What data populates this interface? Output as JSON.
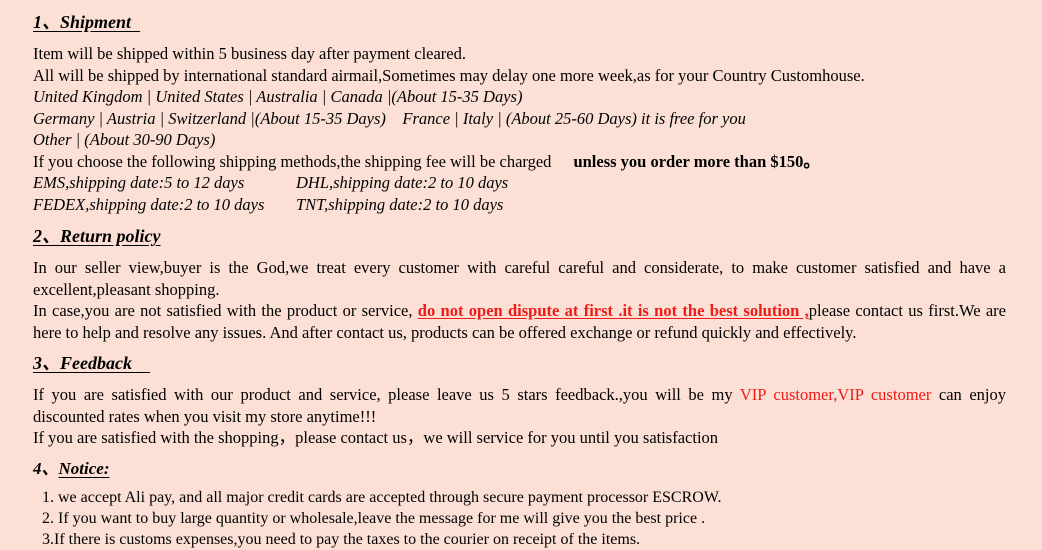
{
  "document": {
    "background_color": "#fce0d6",
    "accent_red": "#ee1b16",
    "text_color": "#000000"
  },
  "sections": {
    "shipment": {
      "number": "1、",
      "title": "Shipment  ",
      "line_1": "Item will be shipped within 5 business day after payment cleared.",
      "line_2": "All will be shipped by international standard airmail,Sometimes may delay one more week,as for your Country Customhouse.",
      "zones": [
        "United Kingdom | United States | Australia | Canada |(About 15-35 Days)",
        "Germany | Austria | Switzerland |(About 15-35 Days)    France | Italy | (About 25-60 Days) it is free for you",
        "Other | (About 30-90 Days)"
      ],
      "fee_line_prefix": "If you choose the following shipping methods,the shipping fee will be charged",
      "fee_line_bold": "unless you order more than $150。",
      "methods": [
        {
          "left": "EMS,shipping date:5 to 12 days",
          "right": "DHL,shipping date:2 to 10 days"
        },
        {
          "left": "FEDEX,shipping date:2 to 10 days",
          "right": "TNT,shipping date:2 to 10 days"
        }
      ]
    },
    "return_policy": {
      "number": "2、",
      "title": "Return policy",
      "paragraph_1": "In our seller view,buyer is the God,we treat every customer with careful careful and considerate, to make customer satisfied and have a excellent,pleasant shopping.",
      "paragraph_2_prefix": "In case,you are not satisfied with the product or service, ",
      "paragraph_2_red": "do not open dispute at first .it is not the best solution ,",
      "paragraph_2_suffix": "please contact us first.We are here to help and resolve any issues. And after contact us, products can be offered exchange or refund quickly and effectively."
    },
    "feedback": {
      "number": "3、",
      "title": "Feedback    ",
      "paragraph_prefix": "If you are satisfied with our product and service, please leave us 5 stars feedback.,you will be my ",
      "paragraph_red": "VIP customer,VIP customer",
      "paragraph_suffix": " can enjoy discounted rates when you visit my store anytime!!!",
      "closing_line": "If you are satisfied with the shopping，please contact us，we will service for you until you satisfaction"
    },
    "notice": {
      "number": "4、",
      "title": "Notice:",
      "items": [
        "1. we accept Ali pay, and all major credit cards are accepted through secure payment processor ESCROW.",
        "2. If you want to buy large quantity or wholesale,leave the message for me will give you the best price .",
        "3.If there is customs expenses,you need to pay the taxes to the courier on receipt of the items."
      ]
    }
  }
}
